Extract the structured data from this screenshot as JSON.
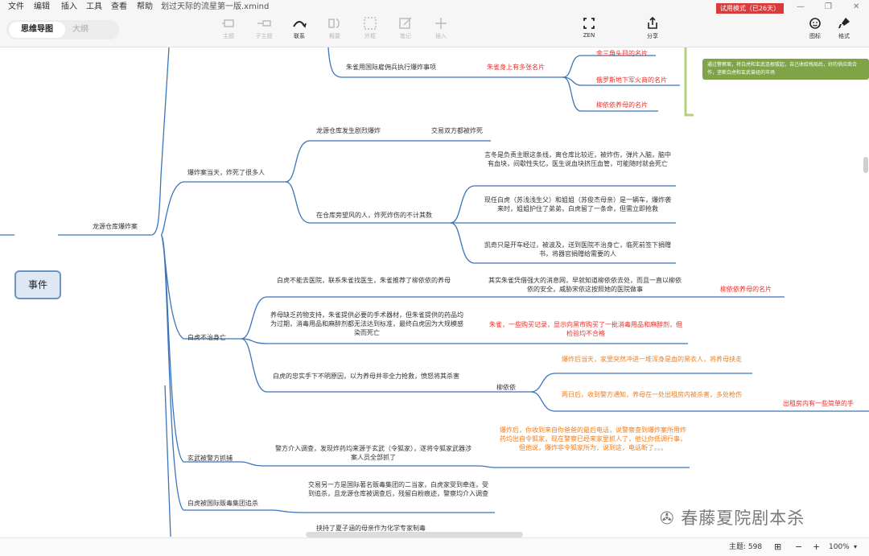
{
  "menu": {
    "items": [
      "文件",
      "编辑",
      "插入",
      "工具",
      "查看",
      "帮助"
    ],
    "doc_title": "划过天际的流星第一版.xmind"
  },
  "toolbar": {
    "view_tabs": {
      "active": "思维导图",
      "inactive": "大纲"
    },
    "buttons": {
      "topic": "主题",
      "subtopic": "子主题",
      "relation": "联系",
      "summary": "概要",
      "boundary": "外框",
      "note": "笔记",
      "insert": "插入",
      "zen": "ZEN",
      "share": "分享",
      "icon": "图标",
      "format": "格式"
    },
    "trial_badge": "试用模式（已26天）"
  },
  "map": {
    "root": "事件",
    "l1": "龙源仓库爆炸案",
    "top": {
      "mercenary": "朱雀用国际雇佣兵执行爆炸事项",
      "list_label": "朱雀身上有多张名片",
      "cards": [
        "金三角头目的名片",
        "俄罗斯地下军火商的名片",
        "柳依依养母的名片"
      ],
      "note": "通过警察案，将白虎和玄武连根拔起，自己收给残局后，好的供应商合作，垄断白虎和玄武曾经的市场"
    },
    "explosion": {
      "label": "爆炸案当天，炸死了很多人",
      "fire": "龙源仓库发生剧烈爆炸",
      "fire_child": "交易双方都被炸死",
      "victims": "在仓库旁望风的人，炸死炸伤的不计其数",
      "v1": "言冬是负责主眼这条线，离仓库比较近，被炸伤，弹片入脑，脑中有血块，间歇性失忆，医生说血块挤压血管，可能随时就会死亡",
      "v2": "现任白虎（苏浅浅生父）和姐姐（苏俊杰母亲）是一辆车，爆炸袭来时，姐姐护住了弟弟，白虎留了一条命，但需立即抢救",
      "v3": "凯奇只是开车经过，被波及，送到医院不治身亡，临死前签下捐赠书，将器官捐赠给需要的人"
    },
    "baihu": {
      "label": "白虎不治身亡",
      "b1": "白虎不能去医院，联系朱雀找医生，朱雀推荐了柳依依的养母",
      "b1c": "其实朱雀凭借强大的消息网，早就知道柳依依去处，而且一直以柳依依的安全，威胁宋依这按照她的医院做事",
      "b1cc": "柳依依养母的名片",
      "b2": "养母缺乏药物支持，朱雀提供必要的手术器材，但朱雀提供的药品均为过期，消毒用品和麻醉剂都无法达到标准，最终白虎因为大规模感染而死亡",
      "b2c": "朱雀，一些购买记录，显示向黑市购买了一批消毒用品和麻醉剂，但检验均不合格",
      "b3": "白虎的忠实手下不明原因，以为养母并非全力抢救，愤怒将其杀害",
      "b3c": "柳依依",
      "b3c1": "爆炸后当天，家里突然冲进一堆浑身是血的黑衣人，将养母挟走",
      "b3c2": "两日后，收到警方通知，养母在一处出租房内被杀害，多处枪伤",
      "b3c2c": "出租房内有一些简单的手"
    },
    "xuanwu": {
      "label": "玄武被警方抓捕",
      "child": "警方介入调查，发现炸药均来源于玄武（令狐家），遂将令狐家武器涉案人员全部抓了",
      "cc": "爆炸后，你收到来自你爸爸的最后电话，说警察查到爆炸案所用炸药均出自令狐家，现在警察已经来家里抓人了，他让你低调行事，但他说，爆炸非令狐家所为，说到这，电话断了。。。"
    },
    "intl": {
      "label": "白虎被国际贩毒集团追杀",
      "child": "交易另一方是国际著名贩毒集团的二当家，白虎家受到牵连，受到追杀，且龙源仓库被调查后，残留白粉痕迹，警察均介入调查"
    },
    "bottom": "挟持了夏子涵的母亲作为化学专家制毒"
  },
  "status": {
    "topics": "主题: 598",
    "zoom": "100%"
  },
  "watermark": "春藤夏院剧本杀",
  "colors": {
    "branch_line": "#3b74b8",
    "red_text": "#e8312b",
    "orange_text": "#f07d1a",
    "note_bg": "#7ea447",
    "trial_bg": "#d83b3b"
  }
}
